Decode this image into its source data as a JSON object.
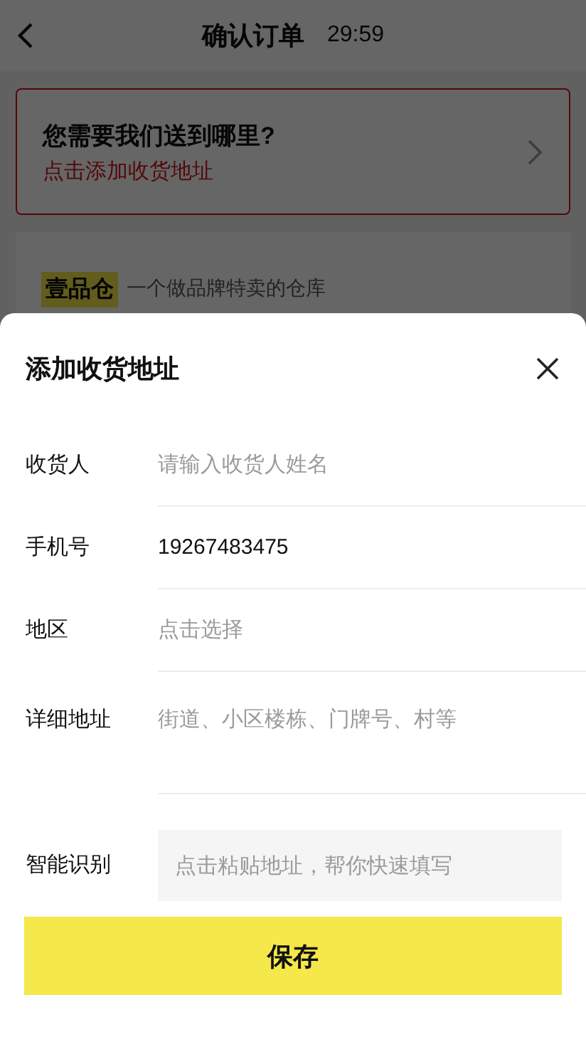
{
  "header": {
    "title": "确认订单",
    "countdown": "29:59"
  },
  "address_card": {
    "title": "您需要我们送到哪里?",
    "action": "点击添加收货地址"
  },
  "shop": {
    "logo": "壹品仓",
    "slogan": "一个做品牌特卖的仓库"
  },
  "sheet": {
    "title": "添加收货地址",
    "fields": [
      {
        "label": "收货人",
        "kind": "text",
        "placeholder": "请输入收货人姓名"
      },
      {
        "label": "手机号",
        "kind": "text",
        "value": "19267483475"
      },
      {
        "label": "地区",
        "kind": "picker",
        "placeholder": "点击选择"
      },
      {
        "label": "详细地址",
        "kind": "textarea",
        "placeholder": "街道、小区楼栋、门牌号、村等"
      },
      {
        "label": "智能识别",
        "kind": "paste",
        "placeholder": "点击粘贴地址，帮你快速填写"
      }
    ],
    "save_button": "保存"
  }
}
